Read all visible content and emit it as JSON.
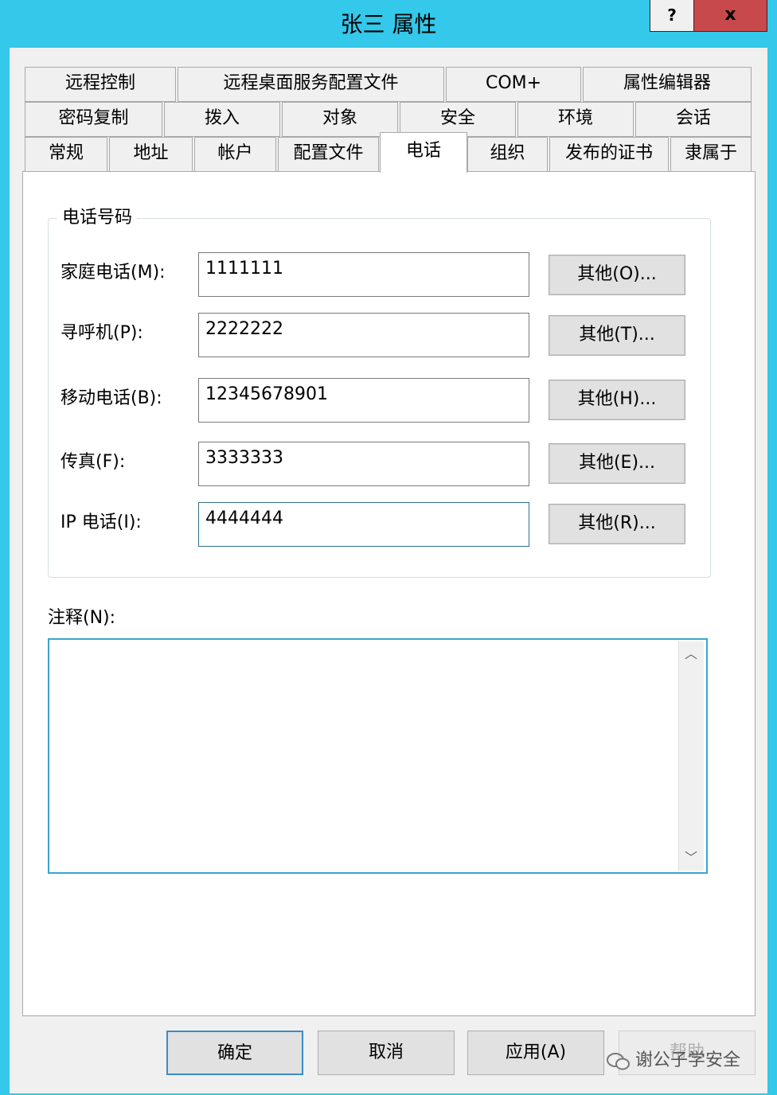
{
  "window": {
    "title": "张三 属性",
    "help_glyph": "?",
    "close_glyph": "x"
  },
  "tabs": {
    "row1": [
      "远程控制",
      "远程桌面服务配置文件",
      "COM+",
      "属性编辑器"
    ],
    "row2": [
      "密码复制",
      "拨入",
      "对象",
      "安全",
      "环境",
      "会话"
    ],
    "row3": [
      "常规",
      "地址",
      "帐户",
      "配置文件",
      "电话",
      "组织",
      "发布的证书",
      "隶属于"
    ],
    "selected": "电话"
  },
  "phone_group": {
    "legend": "电话号码",
    "rows": [
      {
        "label": "家庭电话(M):",
        "value": "1111111",
        "button": "其他(O)..."
      },
      {
        "label": "寻呼机(P):",
        "value": "2222222",
        "button": "其他(T)..."
      },
      {
        "label": "移动电话(B):",
        "value": "12345678901",
        "button": "其他(H)..."
      },
      {
        "label": "传真(F):",
        "value": "3333333",
        "button": "其他(E)..."
      },
      {
        "label": "IP 电话(I):",
        "value": "4444444",
        "button": "其他(R)..."
      }
    ]
  },
  "notes": {
    "label": "注释(N):",
    "value": ""
  },
  "footer": {
    "ok": "确定",
    "cancel": "取消",
    "apply": "应用(A)",
    "help": "帮助"
  },
  "watermark": "谢公子学安全"
}
